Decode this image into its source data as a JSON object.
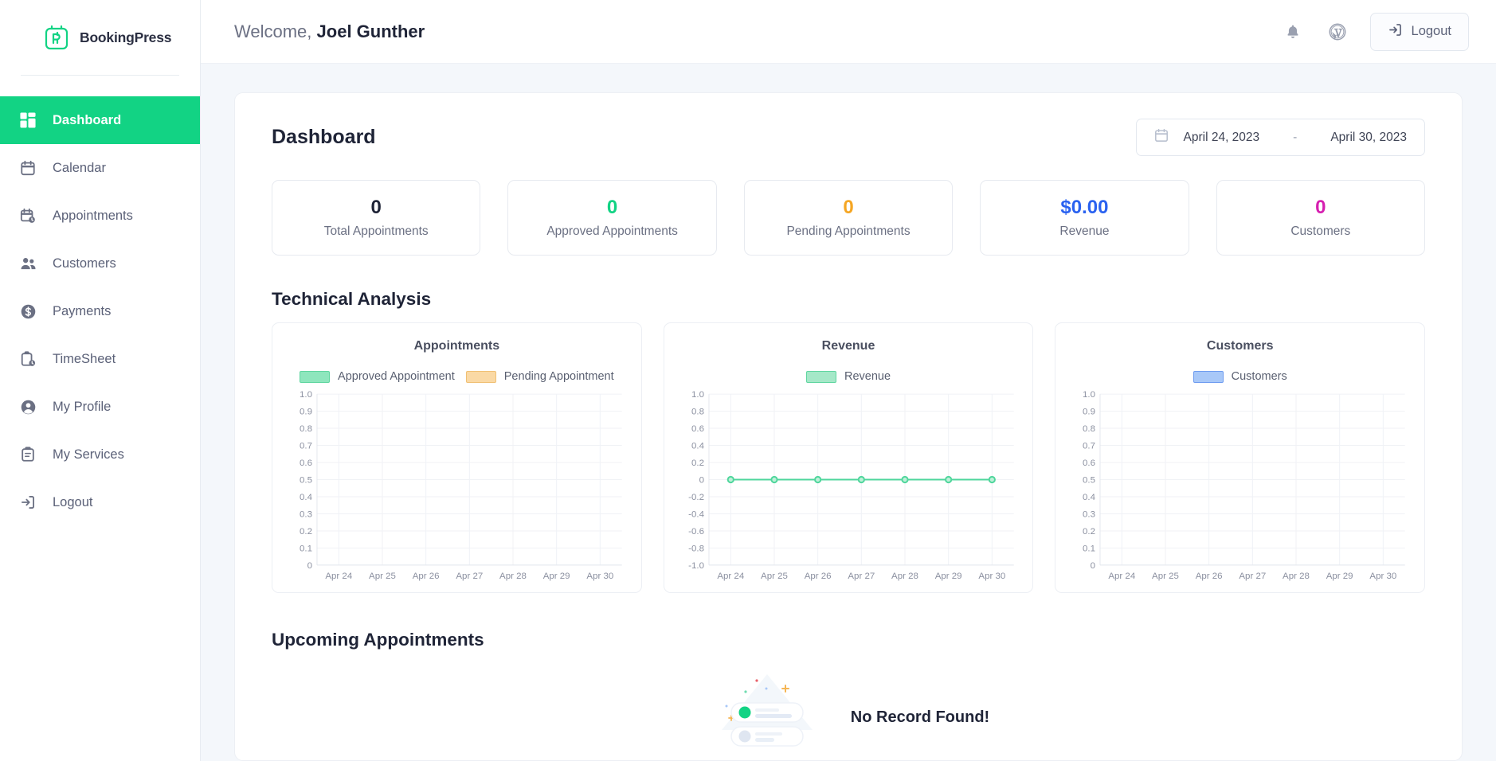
{
  "brand": {
    "name": "BookingPress",
    "logo_icon": "bookingpress-logo-icon"
  },
  "sidebar": {
    "items": [
      {
        "label": "Dashboard",
        "icon": "grid-icon",
        "active": true
      },
      {
        "label": "Calendar",
        "icon": "calendar-icon",
        "active": false
      },
      {
        "label": "Appointments",
        "icon": "calendar-clock-icon",
        "active": false
      },
      {
        "label": "Customers",
        "icon": "people-icon",
        "active": false
      },
      {
        "label": "Payments",
        "icon": "dollar-circle-icon",
        "active": false
      },
      {
        "label": "TimeSheet",
        "icon": "clipboard-clock-icon",
        "active": false
      },
      {
        "label": "My Profile",
        "icon": "user-circle-icon",
        "active": false
      },
      {
        "label": "My Services",
        "icon": "clipboard-icon",
        "active": false
      },
      {
        "label": "Logout",
        "icon": "logout-icon",
        "active": false
      }
    ]
  },
  "topbar": {
    "welcome_prefix": "Welcome,",
    "user_name": "Joel Gunther",
    "bell_icon": "bell-icon",
    "wordpress_icon": "wordpress-icon",
    "logout_label": "Logout",
    "logout_icon": "logout-icon"
  },
  "dashboard": {
    "title": "Dashboard",
    "date_range": {
      "calendar_icon": "calendar-icon",
      "start": "April 24, 2023",
      "separator": "-",
      "end": "April 30, 2023"
    },
    "stats": [
      {
        "value": "0",
        "label": "Total Appointments",
        "color": "#1f2437"
      },
      {
        "value": "0",
        "label": "Approved Appointments",
        "color": "#12d384"
      },
      {
        "value": "0",
        "label": "Pending Appointments",
        "color": "#f5a623"
      },
      {
        "value": "$0.00",
        "label": "Revenue",
        "color": "#2a62f0"
      },
      {
        "value": "0",
        "label": "Customers",
        "color": "#d61fb0"
      }
    ],
    "technical_analysis_title": "Technical Analysis",
    "upcoming_title": "Upcoming Appointments",
    "empty_state": {
      "text": "No Record Found!",
      "illustration_icon": "empty-records-illustration-icon"
    }
  },
  "chart_data": [
    {
      "type": "bar",
      "title": "Appointments",
      "categories": [
        "Apr 24",
        "Apr 25",
        "Apr 26",
        "Apr 27",
        "Apr 28",
        "Apr 29",
        "Apr 30"
      ],
      "series": [
        {
          "name": "Approved Appointment",
          "color": "#8ee6bd",
          "values": [
            0,
            0,
            0,
            0,
            0,
            0,
            0
          ]
        },
        {
          "name": "Pending Appointment",
          "color": "#fad9a5",
          "values": [
            0,
            0,
            0,
            0,
            0,
            0,
            0
          ]
        }
      ],
      "yticks": [
        "1.0",
        "0.9",
        "0.8",
        "0.7",
        "0.6",
        "0.5",
        "0.4",
        "0.3",
        "0.2",
        "0.1",
        "0"
      ],
      "ylim": [
        0,
        1
      ],
      "xlabel": "",
      "ylabel": "",
      "grid": true,
      "legend_position": "top"
    },
    {
      "type": "line",
      "title": "Revenue",
      "categories": [
        "Apr 24",
        "Apr 25",
        "Apr 26",
        "Apr 27",
        "Apr 28",
        "Apr 29",
        "Apr 30"
      ],
      "series": [
        {
          "name": "Revenue",
          "color": "#4fd69c",
          "values": [
            0,
            0,
            0,
            0,
            0,
            0,
            0
          ]
        }
      ],
      "yticks": [
        "1.0",
        "0.8",
        "0.6",
        "0.4",
        "0.2",
        "0",
        "-0.2",
        "-0.4",
        "-0.6",
        "-0.8",
        "-1.0"
      ],
      "ylim": [
        -1,
        1
      ],
      "xlabel": "",
      "ylabel": "",
      "grid": true,
      "legend_position": "top"
    },
    {
      "type": "bar",
      "title": "Customers",
      "categories": [
        "Apr 24",
        "Apr 25",
        "Apr 26",
        "Apr 27",
        "Apr 28",
        "Apr 29",
        "Apr 30"
      ],
      "series": [
        {
          "name": "Customers",
          "color": "#a8c8f8",
          "values": [
            0,
            0,
            0,
            0,
            0,
            0,
            0
          ]
        }
      ],
      "yticks": [
        "1.0",
        "0.9",
        "0.8",
        "0.7",
        "0.6",
        "0.5",
        "0.4",
        "0.3",
        "0.2",
        "0.1",
        "0"
      ],
      "ylim": [
        0,
        1
      ],
      "xlabel": "",
      "ylabel": "",
      "grid": true,
      "legend_position": "top"
    }
  ]
}
